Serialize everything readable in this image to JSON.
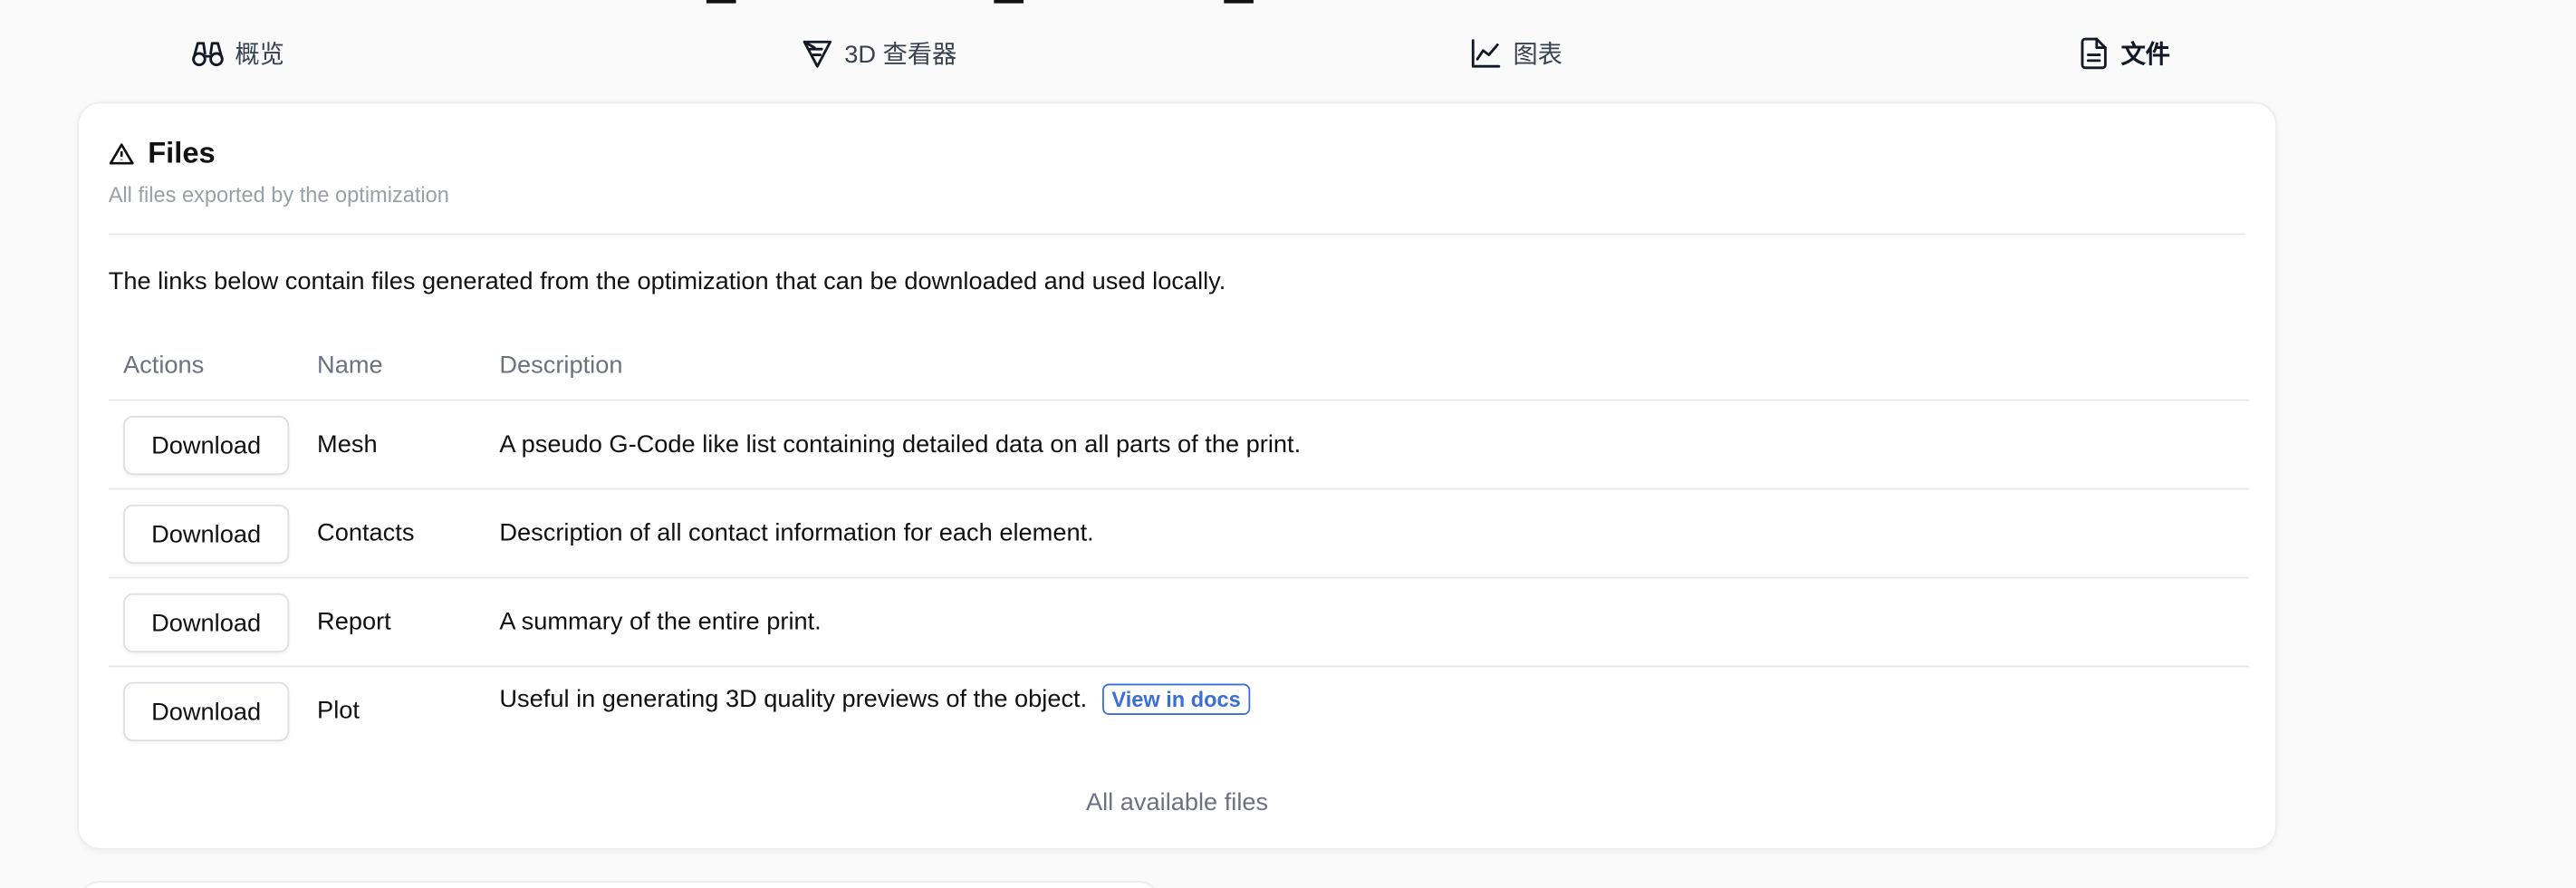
{
  "tabs": [
    {
      "label": "概览",
      "icon": "binoculars-icon"
    },
    {
      "label": "3D 查看器",
      "icon": "printer-3d-icon"
    },
    {
      "label": "图表",
      "icon": "line-chart-icon"
    },
    {
      "label": "文件",
      "icon": "file-icon",
      "active": true
    }
  ],
  "card": {
    "title": "Files",
    "subtitle": "All files exported by the optimization",
    "intro": "The links below contain files generated from the optimization that can be downloaded and used locally.",
    "columns": {
      "actions": "Actions",
      "name": "Name",
      "description": "Description"
    },
    "rows": [
      {
        "action": "Download",
        "name": "Mesh",
        "description": "A pseudo G-Code like list containing detailed data on all parts of the print."
      },
      {
        "action": "Download",
        "name": "Contacts",
        "description": "Description of all contact information for each element."
      },
      {
        "action": "Download",
        "name": "Report",
        "description": "A summary of the entire print."
      },
      {
        "action": "Download",
        "name": "Plot",
        "description": "Useful in generating 3D quality previews of the object.",
        "link": "View in docs"
      }
    ],
    "footer": "All available files"
  },
  "colors": {
    "link": "#3b6fd6",
    "muted": "#6b7280",
    "border": "#e5e7eb"
  }
}
